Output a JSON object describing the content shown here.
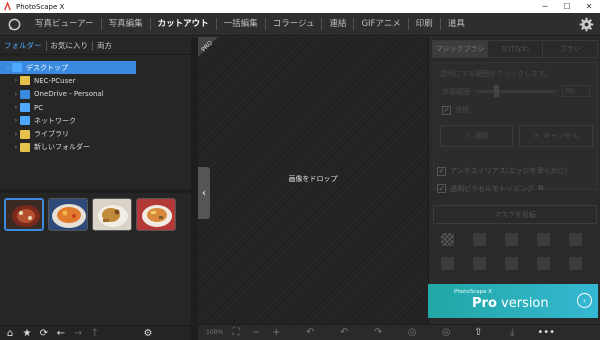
{
  "window": {
    "title": "PhotoScape X",
    "minimize": "─",
    "maximize": "☐",
    "close": "✕"
  },
  "menu": {
    "items": [
      "写真ビューアー",
      "写真編集",
      "カットアウト",
      "一括編集",
      "コラージュ",
      "連結",
      "GIFアニメ",
      "印刷",
      "道具"
    ],
    "active_index": 2
  },
  "left": {
    "tabs": [
      "フォルダー",
      "お気に入り",
      "両方"
    ],
    "tree": [
      {
        "label": "デスクトップ",
        "icon": "desktop-folder-icon",
        "indent": 0,
        "selected": true
      },
      {
        "label": "NEC-PCuser",
        "icon": "user-folder-icon",
        "indent": 1
      },
      {
        "label": "OneDrive - Personal",
        "icon": "cloud-icon",
        "indent": 1
      },
      {
        "label": "PC",
        "icon": "pc-icon",
        "indent": 1
      },
      {
        "label": "ネットワーク",
        "icon": "network-icon",
        "indent": 1
      },
      {
        "label": "ライブラリ",
        "icon": "library-icon",
        "indent": 1
      },
      {
        "label": "新しいフォルダー",
        "icon": "folder-icon",
        "indent": 1
      }
    ]
  },
  "canvas": {
    "drop_text": "画像をドロップ",
    "ribbon": "PRO"
  },
  "bottom_bar": {
    "zoom": "100%"
  },
  "right": {
    "tabs": [
      "マジックブラシ",
      "なげなわ",
      "ブラシ"
    ],
    "hint": "透明にする範囲をクリックします。",
    "slider_label": "許容範囲",
    "slider_value": "30",
    "checkbox_label": "連続",
    "apply_label": "適用",
    "cancel_label": "キャンセル",
    "antialias_label": "アンチエイリアス(エッジを滑らかに)",
    "trim_label": "透明ピクセルをトリミング",
    "invert_label": "マスクを反転"
  },
  "promo": {
    "small": "PhotoScape X",
    "brand": "Pro",
    "suffix": " version"
  },
  "colors": {
    "accent": "#3a8be0",
    "promo_start": "#21a7a5",
    "promo_end": "#35b8d2"
  }
}
